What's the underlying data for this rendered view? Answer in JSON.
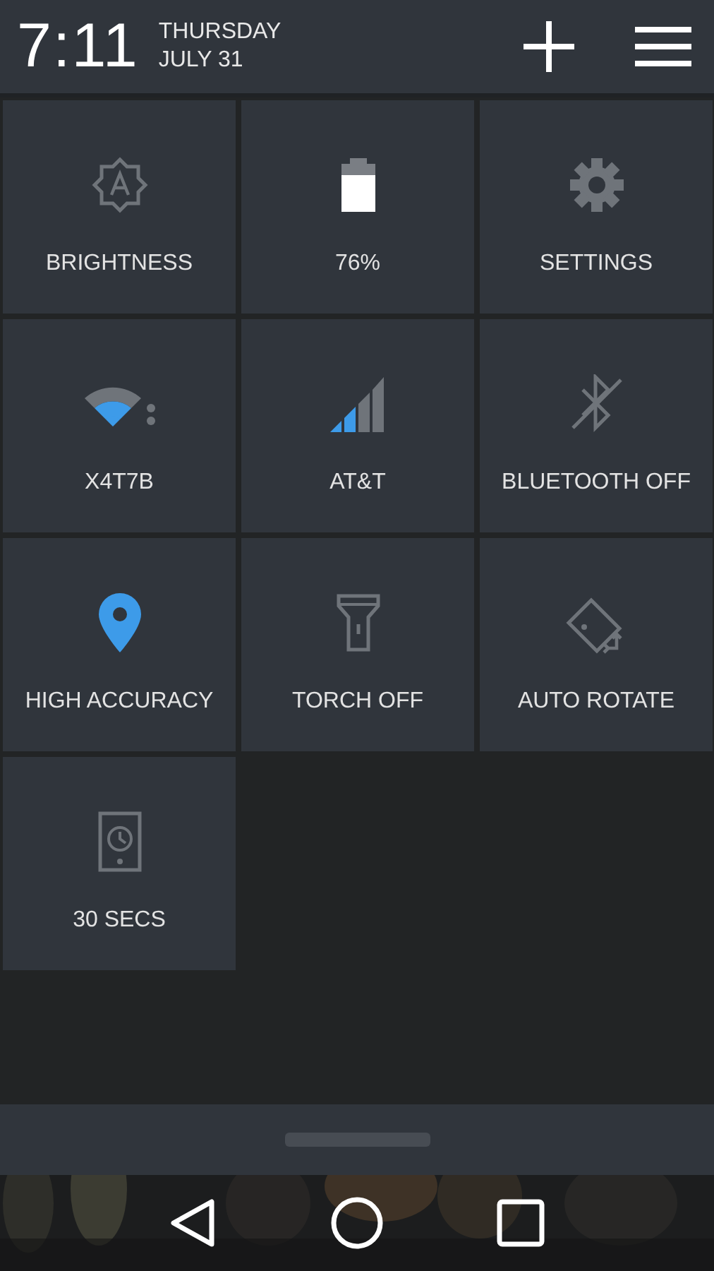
{
  "header": {
    "time": "7:11",
    "day": "THURSDAY",
    "date": "JULY 31"
  },
  "tiles": [
    {
      "kind": "brightness",
      "label": "BRIGHTNESS"
    },
    {
      "kind": "battery",
      "label": "76%"
    },
    {
      "kind": "settings",
      "label": "SETTINGS"
    },
    {
      "kind": "wifi",
      "label": "X4T7B"
    },
    {
      "kind": "signal",
      "label": "AT&T"
    },
    {
      "kind": "bluetooth",
      "label": "BLUETOOTH OFF",
      "on": false
    },
    {
      "kind": "location",
      "label": "HIGH ACCURACY",
      "on": true
    },
    {
      "kind": "torch",
      "label": "TORCH OFF",
      "on": false
    },
    {
      "kind": "rotate",
      "label": "AUTO ROTATE"
    },
    {
      "kind": "timeout",
      "label": "30 SECS"
    }
  ]
}
